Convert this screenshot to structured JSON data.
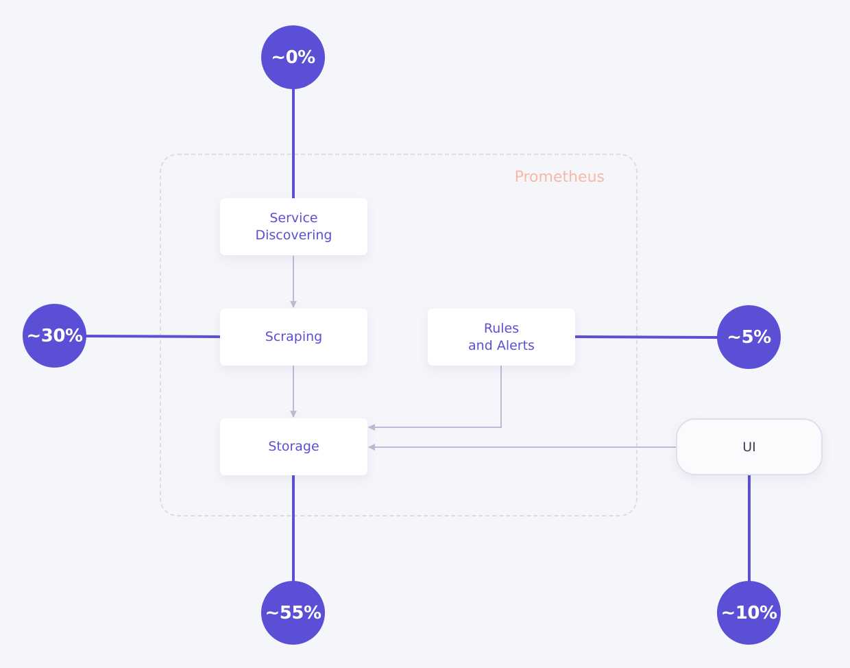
{
  "region": {
    "label": "Prometheus"
  },
  "components": {
    "service_discovering": "Service\nDiscovering",
    "scraping": "Scraping",
    "rules_alerts": "Rules\nand Alerts",
    "storage": "Storage",
    "ui": "UI"
  },
  "shares": {
    "service_discovering": "~0%",
    "scraping": "~30%",
    "rules_alerts": "~5%",
    "storage": "~55%",
    "ui": "~10%"
  },
  "colors": {
    "accent": "#5b4fd5",
    "region_label": "#f9b7a5",
    "arrow": "#bdbad6",
    "background": "#f5f6fa"
  }
}
